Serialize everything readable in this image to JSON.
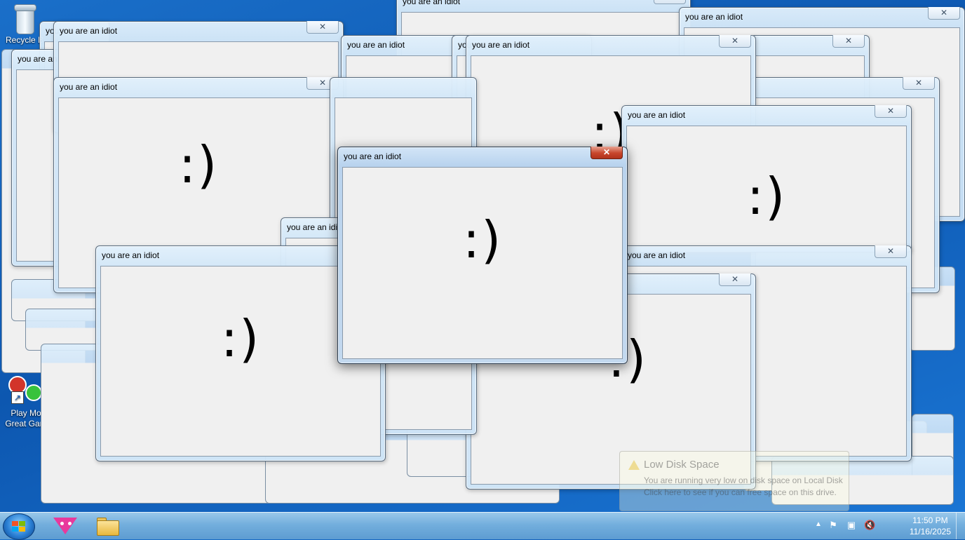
{
  "desktop": {
    "icons": [
      {
        "label": "Recycle B",
        "icon": "recycle-bin-icon"
      },
      {
        "label": "Play Mo\nGreat Gam",
        "icon": "game-shortcut-icon"
      }
    ]
  },
  "dialog": {
    "title": "you are an idiot",
    "message": ":)",
    "close_glyph": "✕"
  },
  "notification": {
    "title": "Low Disk Space",
    "line1": "You are running very low on disk space on Local Disk",
    "line2": "Click here to see if you can free space on this drive."
  },
  "taskbar": {
    "pinned": [
      "browser-app-icon",
      "file-explorer-icon"
    ],
    "tray_icons": [
      "show-hidden-icons-chevron",
      "action-center-flag-icon",
      "network-icon",
      "volume-muted-icon"
    ],
    "time": "11:50 PM",
    "date": "11/16/2025"
  }
}
